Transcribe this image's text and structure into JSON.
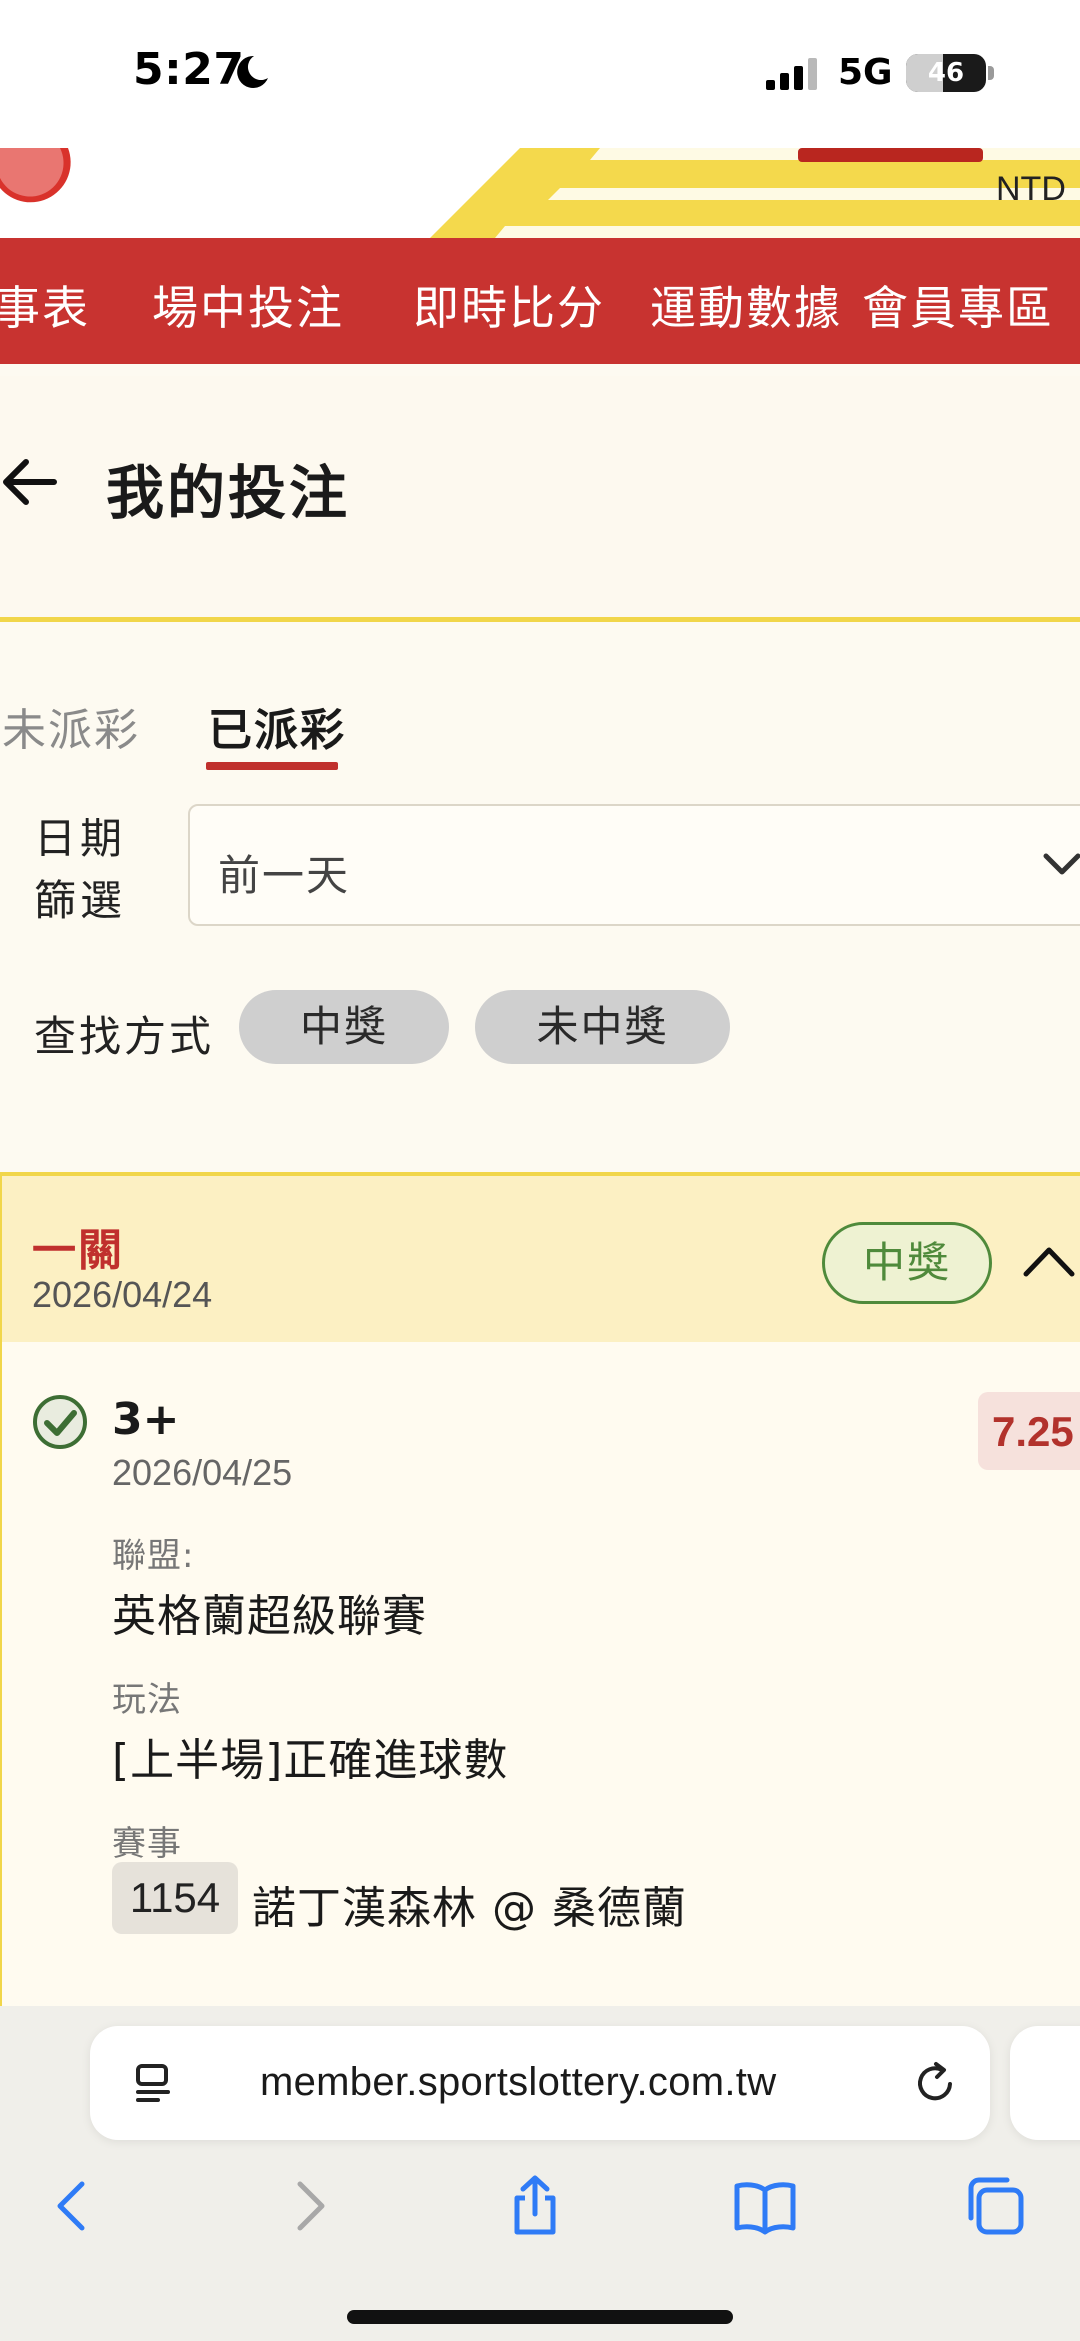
{
  "status_bar": {
    "time": "5:27",
    "network": "5G",
    "battery": "46",
    "battery_level": 0.46
  },
  "banner": {
    "currency": "NTD"
  },
  "nav": {
    "items": [
      "事表",
      "場中投注",
      "即時比分",
      "運動數據",
      "會員專區"
    ]
  },
  "page": {
    "title": "我的投注"
  },
  "tabs": {
    "unsettled": "未派彩",
    "settled": "已派彩"
  },
  "filter": {
    "label": "日期篩選",
    "value": "前一天"
  },
  "search": {
    "label": "查找方式",
    "options": [
      "中獎",
      "未中獎"
    ]
  },
  "bet": {
    "type": "一關",
    "date": "2026/04/24",
    "status": "中獎",
    "selection": "3+",
    "match_date": "2026/04/25",
    "odds": "7.25",
    "league_label": "聯盟:",
    "league": "英格蘭超級聯賽",
    "market_label": "玩法",
    "market": "[上半場]正確進球數",
    "event_label": "賽事",
    "event_code": "1154",
    "event_name": "諾丁漢森林 @ 桑德蘭"
  },
  "browser": {
    "url": "member.sportslottery.com.tw"
  },
  "colors": {
    "brand_red": "#c83330",
    "accent_yellow": "#f1d64a",
    "win_green": "#4f8a3b"
  }
}
